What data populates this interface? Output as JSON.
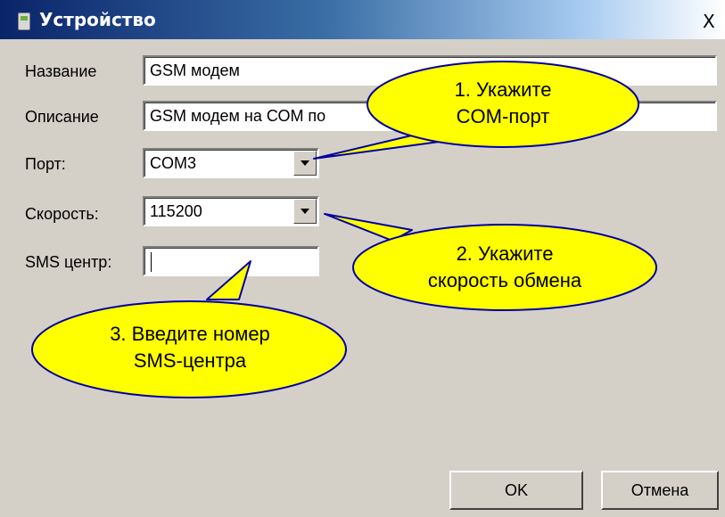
{
  "window": {
    "title": "Устройство",
    "close_glyph": "X",
    "icons": [
      "app-icon",
      "close-icon"
    ]
  },
  "form": {
    "name": {
      "label": "Название",
      "value": "GSM модем"
    },
    "description": {
      "label": "Описание",
      "value": "GSM модем на СОМ по"
    },
    "port": {
      "label": "Порт:",
      "value": "COM3"
    },
    "speed": {
      "label": "Скорость:",
      "value": "115200"
    },
    "sms_center": {
      "label": "SMS центр:",
      "value": ""
    }
  },
  "buttons": {
    "ok": "OK",
    "cancel": "Отмена"
  },
  "callouts": [
    {
      "text": "1. Укажите\nCOM-порт"
    },
    {
      "text": "2. Укажите\nскорость обмена"
    },
    {
      "text": "3. Введите номер\nSMS-центра"
    }
  ],
  "colors": {
    "window_bg": "#d4d0c8",
    "title_gradient_start": "#0a246a",
    "title_gradient_end": "#a6caf0",
    "callout_fill": "#ffff00",
    "callout_stroke": "#0000a0"
  }
}
